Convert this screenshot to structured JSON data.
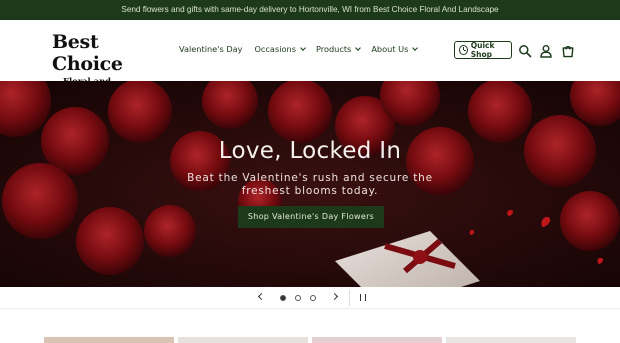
{
  "announcement": "Send flowers and gifts with same-day delivery to Hortonville, WI from Best Choice Floral And Landscape",
  "logo": {
    "title": "Best Choice",
    "subtitle": "Floral and Landscape"
  },
  "nav": [
    {
      "label": "Valentine's Day",
      "has_dropdown": false
    },
    {
      "label": "Occasions",
      "has_dropdown": true
    },
    {
      "label": "Products",
      "has_dropdown": true
    },
    {
      "label": "About Us",
      "has_dropdown": true
    }
  ],
  "quick_shop": {
    "label": "Quick Shop",
    "icon": "clock-icon"
  },
  "header_icons": [
    "search-icon",
    "account-icon",
    "cart-icon"
  ],
  "hero": {
    "title": "Love, Locked In",
    "subtitle": "Beat the Valentine's rush and secure the freshest blooms today.",
    "button": "Shop Valentine's Day Flowers"
  },
  "slider": {
    "slides": 3,
    "active": 1
  },
  "colors": {
    "brand_green": "#1c3a1a",
    "announce_text": "#d9e3c9",
    "rose_red": "#8e0f14"
  }
}
